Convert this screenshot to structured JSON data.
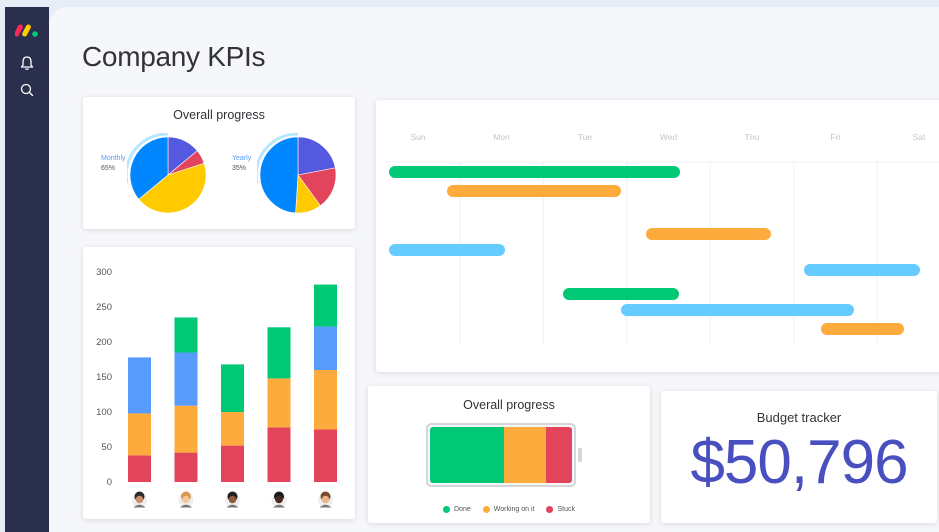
{
  "app": {
    "name": "monday.com"
  },
  "sidebar": {
    "logo_colors": [
      "#fb275d",
      "#ffcb00",
      "#00ca72"
    ],
    "icons": [
      "bell-icon",
      "search-icon"
    ]
  },
  "page": {
    "title": "Company KPIs"
  },
  "progress_card": {
    "title": "Overall progress",
    "monthly": {
      "label": "Monthly",
      "value": "65%"
    },
    "yearly": {
      "label": "Yearly",
      "value": "35%"
    }
  },
  "chart_data": [
    {
      "type": "pie",
      "title": "Monthly",
      "slices": [
        {
          "color": "#5559df",
          "value": 14
        },
        {
          "color": "#e2445c",
          "value": 6
        },
        {
          "color": "#ffcb00",
          "value": 44
        },
        {
          "color": "#0086ff",
          "value": 36
        }
      ]
    },
    {
      "type": "pie",
      "title": "Yearly",
      "slices": [
        {
          "color": "#5559df",
          "value": 22
        },
        {
          "color": "#e2445c",
          "value": 18
        },
        {
          "color": "#ffcb00",
          "value": 11
        },
        {
          "color": "#0086ff",
          "value": 49
        }
      ]
    },
    {
      "type": "bar",
      "stacked": true,
      "categories": [
        "1",
        "2",
        "3",
        "4",
        "5"
      ],
      "ylim": [
        0,
        300
      ],
      "yticks": [
        "0",
        "50",
        "100",
        "150",
        "200",
        "250",
        "300"
      ],
      "series": [
        {
          "color": "#e2445c",
          "values": [
            38,
            42,
            52,
            78,
            75
          ]
        },
        {
          "color": "#fdab3d",
          "values": [
            60,
            67,
            48,
            70,
            85
          ]
        },
        {
          "color": "#579bfc",
          "values": [
            80,
            76,
            0,
            0,
            62
          ]
        },
        {
          "color": "#00c875",
          "values": [
            0,
            50,
            68,
            73,
            60
          ]
        }
      ]
    },
    {
      "type": "gantt",
      "days": [
        "Sun",
        "Mon",
        "Tue",
        "Wed",
        "Thu",
        "Fri",
        "Sat"
      ],
      "tasks": [
        {
          "start": 0.0,
          "end": 3.5,
          "color": "#00c875"
        },
        {
          "start": 0.7,
          "end": 2.8,
          "color": "#fdab3d"
        },
        {
          "start": 3.1,
          "end": 4.6,
          "color": "#fdab3d"
        },
        {
          "start": 0.0,
          "end": 1.4,
          "color": "#66ccff"
        },
        {
          "start": 5.0,
          "end": 6.4,
          "color": "#66ccff"
        },
        {
          "start": 2.1,
          "end": 3.5,
          "color": "#00c875"
        },
        {
          "start": 2.8,
          "end": 5.6,
          "color": "#66ccff"
        },
        {
          "start": 5.2,
          "end": 6.2,
          "color": "#fdab3d"
        }
      ]
    },
    {
      "type": "bar",
      "stacked": true,
      "orientation": "horizontal",
      "title": "Overall progress",
      "series": [
        {
          "name": "Done",
          "color": "#00c875",
          "value": 52
        },
        {
          "name": "Working on it",
          "color": "#fdab3d",
          "value": 30
        },
        {
          "name": "Stuck",
          "color": "#e2445c",
          "value": 18
        }
      ]
    }
  ],
  "stacked_card": {
    "avatars": [
      "person-avatar-1",
      "person-avatar-2",
      "person-avatar-3",
      "person-avatar-4",
      "person-avatar-5"
    ]
  },
  "battery_card": {
    "title": "Overall progress",
    "legend": [
      {
        "label": "Done",
        "color": "#00c875"
      },
      {
        "label": "Working on it",
        "color": "#fdab3d"
      },
      {
        "label": "Stuck",
        "color": "#e2445c"
      }
    ]
  },
  "budget_card": {
    "title": "Budget tracker",
    "value": "$50,796"
  }
}
